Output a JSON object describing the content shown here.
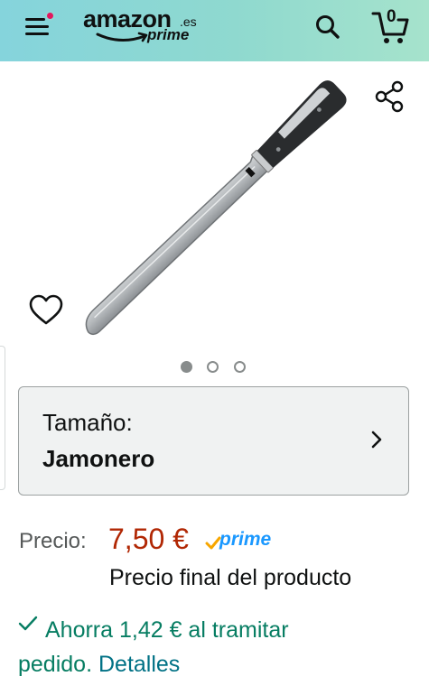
{
  "header": {
    "logo_word": "amazon",
    "logo_tld": ".es",
    "logo_prime": "prime",
    "cart_count": "0",
    "colors": {
      "gradient_start": "#85d4dc",
      "gradient_end": "#a6e3cc",
      "notification_dot": "#e3175e"
    },
    "icons": [
      "menu-icon",
      "search-icon",
      "cart-icon"
    ]
  },
  "gallery": {
    "image_subject": "ham slicing knife",
    "image_count": 3,
    "active_index": 0,
    "icons": [
      "share-icon",
      "heart-icon"
    ]
  },
  "size_selector": {
    "label": "Tamaño:",
    "value": "Jamonero"
  },
  "pricing": {
    "label": "Precio:",
    "value": "7,50 €",
    "prime_badge": "prime",
    "final_price_note": "Precio final del producto",
    "colors": {
      "price": "#b12704",
      "prime": "#1a98ff",
      "savings": "#067d62",
      "link": "#007185"
    }
  },
  "savings": {
    "text_line1": "Ahorra 1,42 € al tramitar",
    "text_line2": "pedido.",
    "link_text": "Detalles"
  }
}
